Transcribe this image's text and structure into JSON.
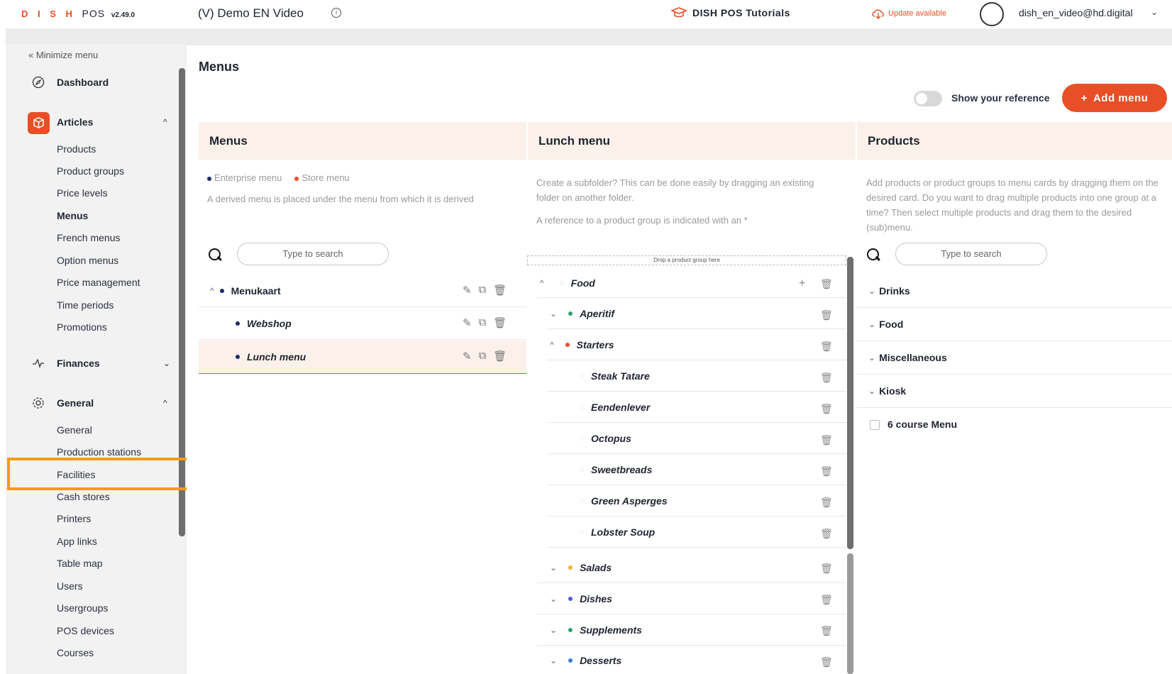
{
  "topbar": {
    "brand": "D I S H",
    "brand_pos": "POS",
    "version": "v2.49.0",
    "store_name": "(V) Demo EN Video",
    "tutorials": "DISH POS Tutorials",
    "update": "Update available",
    "user": "dish_en_video@hd.digital"
  },
  "sidebar": {
    "minimize": "Minimize menu",
    "dashboard": "Dashboard",
    "articles": "Articles",
    "articles_items": [
      "Products",
      "Product groups",
      "Price levels",
      "Menus",
      "French menus",
      "Option menus",
      "Price management",
      "Time periods",
      "Promotions"
    ],
    "finances": "Finances",
    "general": "General",
    "general_items": [
      "General",
      "Production stations",
      "Facilities",
      "Cash stores",
      "Printers",
      "App links",
      "Table map",
      "Users",
      "Usergroups",
      "POS devices",
      "Courses"
    ]
  },
  "page": {
    "title": "Menus",
    "show_reference": "Show your reference",
    "add_menu": "Add menu"
  },
  "menus_col": {
    "title": "Menus",
    "legend_enterprise": "Enterprise menu",
    "legend_store": "Store menu",
    "desc": "A derived menu is placed under the menu from which it is derived",
    "search_placeholder": "Type to search",
    "items": [
      "Menukaart",
      "Webshop",
      "Lunch menu"
    ]
  },
  "lunch_col": {
    "title": "Lunch menu",
    "desc1": "Create a subfolder? This can be done easily by dragging an existing folder on another folder.",
    "desc2": "A reference to a product group is indicated with an *",
    "drop_zone": "Drop a product group here",
    "root": "Food",
    "groups": [
      "Aperitif",
      "Starters"
    ],
    "starters": [
      "Steak Tatare",
      "Eendenlever",
      "Octopus",
      "Sweetbreads",
      "Green Asperges",
      "Lobster Soup"
    ],
    "groups_after": [
      "Salads",
      "Dishes",
      "Supplements",
      "Desserts"
    ]
  },
  "products_col": {
    "title": "Products",
    "desc": "Add products or product groups to menu cards by dragging them on the desired card. Do you want to drag multiple products into one group at a time? Then select multiple products and drag them to the desired (sub)menu.",
    "search_placeholder": "Type to search",
    "groups": [
      "Drinks",
      "Food",
      "Miscellaneous",
      "Kiosk"
    ],
    "product": "6 course Menu"
  },
  "colors": {
    "accent": "#e84f26",
    "enterprise_dot": "#1f2a6b",
    "highlight": "#f39c12",
    "aperitif_dot": "#2e9e6b",
    "starters_dot": "#e84f26",
    "salads_dot": "#f0b429",
    "dishes_dot": "#4a5de0",
    "supplements_dot": "#2e9e6b",
    "desserts_dot": "#3b7dd8"
  }
}
